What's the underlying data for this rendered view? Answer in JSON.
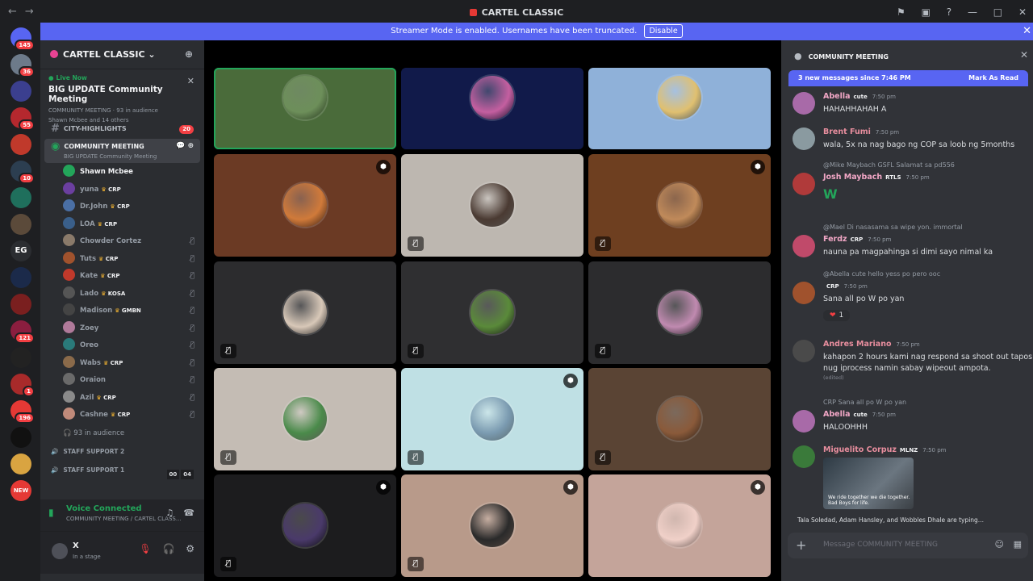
{
  "titlebar": {
    "title": "CARTEL CLASSIC"
  },
  "banner": {
    "text": "Streamer Mode is enabled. Usernames have been truncated.",
    "button": "Disable"
  },
  "guilds": [
    {
      "color": "#5865f2",
      "badge": "145"
    },
    {
      "color": "#6d7a8a",
      "badge": "36"
    },
    {
      "color": "#3b3f8f",
      "badge": ""
    },
    {
      "color": "#b5282e",
      "badge": "55"
    },
    {
      "color": "#c0392b",
      "badge": ""
    },
    {
      "color": "#2c3e50",
      "badge": "10"
    },
    {
      "color": "#1f6f5c",
      "badge": ""
    },
    {
      "color": "#5b4a3a",
      "badge": ""
    },
    {
      "color": "#2b2d31",
      "badge": "",
      "label": "EG"
    },
    {
      "color": "#1b2a4a",
      "badge": ""
    },
    {
      "color": "#7a1f1f",
      "badge": ""
    },
    {
      "color": "#8b1e3f",
      "badge": "121"
    },
    {
      "color": "#222",
      "badge": ""
    },
    {
      "color": "#a82a2a",
      "badge": "1"
    },
    {
      "color": "#e53935",
      "badge": "196"
    },
    {
      "color": "#111",
      "badge": ""
    },
    {
      "color": "#d9a441",
      "badge": ""
    },
    {
      "color": "#e53935",
      "badge": "",
      "label": "NEW"
    }
  ],
  "server": {
    "name": "CARTEL CLASSIC ⌄"
  },
  "event": {
    "live": "Live Now",
    "title": "BIG UPDATE Community Meeting",
    "meta": "COMMUNITY MEETING  ·  93 in audience",
    "meta2": "Shawn Mcbee and 14 others"
  },
  "channels": {
    "highlights": {
      "name": "CITY-HIGHLIGHTS",
      "badge": "20"
    },
    "meeting": {
      "name": "COMMUNITY MEETING",
      "sub": "BIG UPDATE Community Meeting"
    }
  },
  "members": [
    {
      "name": "Shawn Mcbee",
      "tag": "",
      "color": "#23a55a"
    },
    {
      "name": "yuna",
      "tag": "CRP",
      "color": "#6b3fa0"
    },
    {
      "name": "Dr.John",
      "tag": "CRP",
      "color": "#4a6fa5"
    },
    {
      "name": "LOA",
      "tag": "CRP",
      "color": "#3a5f8a"
    },
    {
      "name": "Chowder Cortez",
      "tag": "",
      "color": "#8a7a6a"
    },
    {
      "name": "Tuts",
      "tag": "CRP",
      "color": "#a0522d"
    },
    {
      "name": "Kate",
      "tag": "CRP",
      "color": "#c0392b"
    },
    {
      "name": "Lado",
      "tag": "KOSA",
      "color": "#555"
    },
    {
      "name": "Madison",
      "tag": "GMBN",
      "color": "#444"
    },
    {
      "name": "Zoey",
      "tag": "",
      "color": "#b07a9a"
    },
    {
      "name": "Oreo",
      "tag": "",
      "color": "#2a7a7a"
    },
    {
      "name": "Wabs",
      "tag": "CRP",
      "color": "#8a6a4a"
    },
    {
      "name": "Oraion",
      "tag": "",
      "color": "#6a6a6a"
    },
    {
      "name": "Azil",
      "tag": "CRP",
      "color": "#8a8a8a"
    },
    {
      "name": "Cashne",
      "tag": "CRP",
      "color": "#c08a7a"
    }
  ],
  "audience": "93 in audience",
  "voice_channels": [
    {
      "name": "STAFF SUPPORT 2",
      "count": []
    },
    {
      "name": "STAFF SUPPORT 1",
      "count": [
        "00",
        "04"
      ]
    }
  ],
  "voice": {
    "status": "Voice Connected",
    "channel": "COMMUNITY MEETING / CARTEL CLASS..."
  },
  "user": {
    "name": "X",
    "status": "In a stage"
  },
  "tiles": [
    {
      "bg": "#4a6b3a",
      "av": "#6d8f5a",
      "speaking": true,
      "mute": false,
      "shield": false
    },
    {
      "bg": "#111a4a",
      "av": "#c45fa0",
      "mute": false,
      "shield": false
    },
    {
      "bg": "#8fb1d9",
      "av": "#e0c070",
      "mute": false,
      "shield": false
    },
    {
      "bg": "#6b3a24",
      "av": "#d07a3a",
      "mute": false,
      "shield": true
    },
    {
      "bg": "#bdb7b0",
      "av": "#4a3a32",
      "mute": true,
      "shield": false
    },
    {
      "bg": "#6e3f20",
      "av": "#c08a5a",
      "mute": true,
      "shield": true
    },
    {
      "bg": "#2c2c2e",
      "av": "#d8c8b8",
      "mute": true,
      "shield": false
    },
    {
      "bg": "#2f2f31",
      "av": "#5a8a3a",
      "mute": true,
      "shield": false
    },
    {
      "bg": "#2c2c2e",
      "av": "#c08ab0",
      "mute": true,
      "shield": false
    },
    {
      "bg": "#c4bcb4",
      "av": "#4a8a4a",
      "mute": true,
      "shield": false
    },
    {
      "bg": "#bfe0e4",
      "av": "#7a9ab0",
      "mute": true,
      "shield": true
    },
    {
      "bg": "#5a4434",
      "av": "#8a5a3a",
      "mute": true,
      "shield": false
    },
    {
      "bg": "#1c1c1e",
      "av": "#4a3a6a",
      "mute": true,
      "shield": true
    },
    {
      "bg": "#b89a8a",
      "av": "#2a2a2a",
      "mute": true,
      "shield": true
    },
    {
      "bg": "#c4a49a",
      "av": "#f0d0c8",
      "mute": false,
      "shield": true
    }
  ],
  "chat": {
    "header": "COMMUNITY MEETING",
    "new_bar": "3 new messages since 7:46 PM",
    "mark_read": "Mark As Read",
    "messages": [
      {
        "reply": "",
        "author": "Abella",
        "role": "cute",
        "time": "7:50 pm",
        "text": "HAHAHHAHAH A",
        "color": "#f2a7c6",
        "av": "#a86aa8"
      },
      {
        "reply": "",
        "author": "Brent Fumi",
        "role": "",
        "time": "7:50 pm",
        "text": "wala, 5x na nag bago ng COP sa loob ng 5months",
        "color": "#e88e9e",
        "av": "#8a9aa0"
      },
      {
        "reply": "@Mike Maybach  GSFL  Salamat sa pd556",
        "author": "Josh Maybach",
        "role": "RTLS",
        "time": "7:50 pm",
        "text": "",
        "color": "#f2a7c6",
        "av": "#b03a3a",
        "emote": "W"
      },
      {
        "reply": "@Mael  Di nasasama sa wipe yon. immortal",
        "author": "Ferdz",
        "role": "CRP",
        "time": "7:50 pm",
        "text": "nauna pa magpahinga si dimi sayo nimal ka",
        "color": "#f2a7c6",
        "av": "#c04a6a"
      },
      {
        "reply": "@Abella  cute  hello yess po pero ooc",
        "author": "",
        "role": "CRP",
        "time": "7:50 pm",
        "text": "Sana all po W po yan",
        "color": "#e53935",
        "av": "#a0522d",
        "react": "1"
      },
      {
        "reply": "",
        "author": "Andres Mariano",
        "role": "",
        "time": "7:50 pm",
        "text": "kahapon 2 hours kami nag respond sa shoot out tapos nug iprocess namin sabay wipeout ampota.",
        "color": "#e88e9e",
        "av": "#4a4a4a",
        "edited": "(edited)"
      },
      {
        "reply": "CRP  Sana all po W po yan",
        "author": "Abella",
        "role": "cute",
        "time": "7:50 pm",
        "text": "HALOOHHH",
        "color": "#f2a7c6",
        "av": "#a86aa8"
      },
      {
        "reply": "",
        "author": "Miguelito Corpuz",
        "role": "MLNZ",
        "time": "7:50 pm",
        "text": "",
        "color": "#e88e9e",
        "av": "#3a7a3a",
        "image_caption": "We ride together we die together. Bad Boys for life."
      }
    ],
    "typing": "Tala Soledad, Adam Hansley, and Wobbles Dhale are typing...",
    "composer_placeholder": "Message  COMMUNITY MEETING"
  }
}
